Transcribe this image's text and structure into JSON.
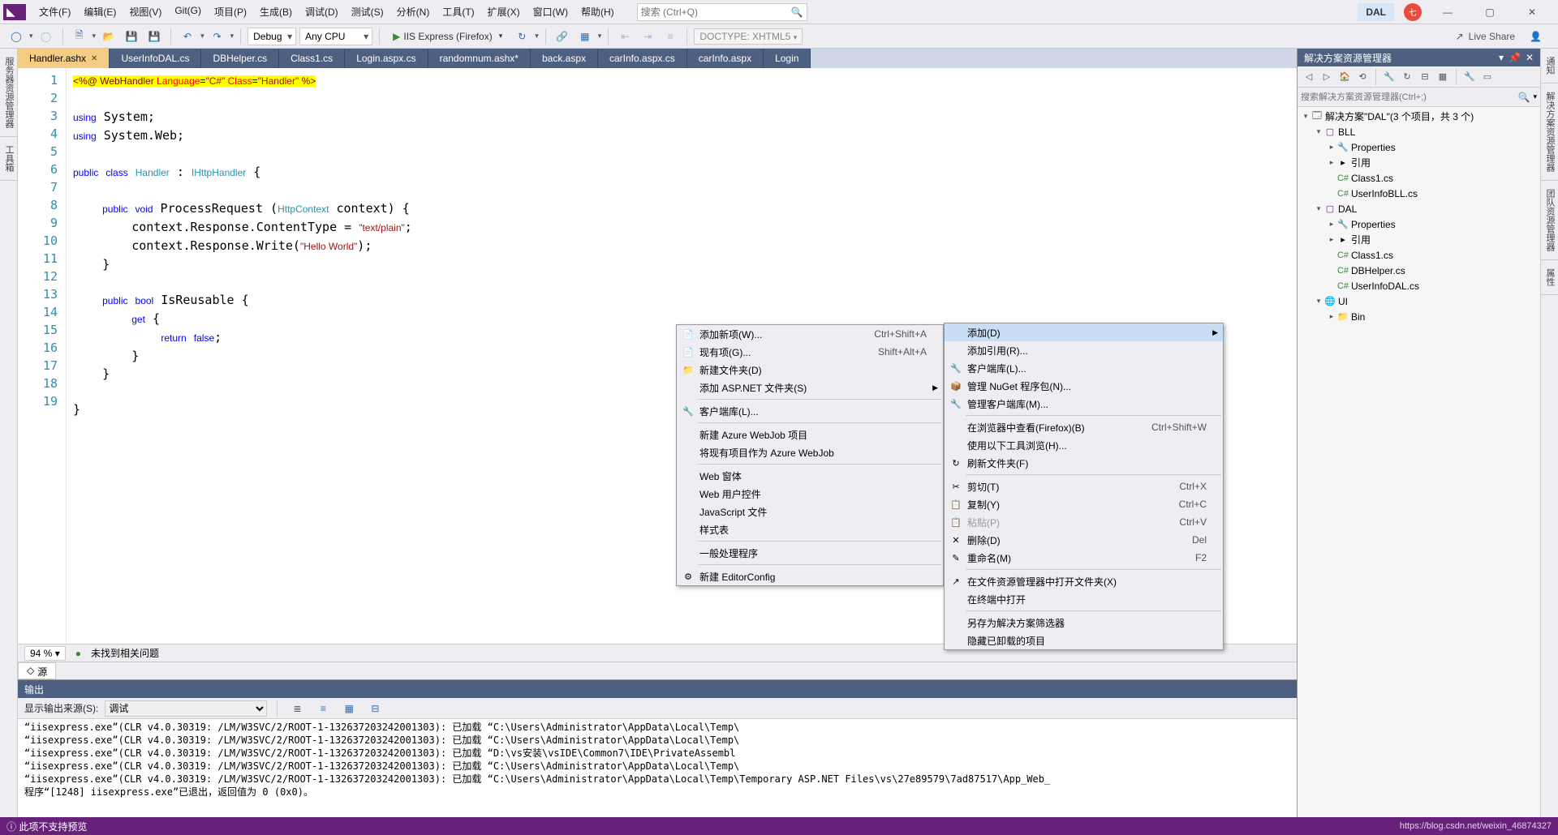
{
  "menu": {
    "items": [
      "文件(F)",
      "编辑(E)",
      "视图(V)",
      "Git(G)",
      "项目(P)",
      "生成(B)",
      "调试(D)",
      "测试(S)",
      "分析(N)",
      "工具(T)",
      "扩展(X)",
      "窗口(W)",
      "帮助(H)"
    ],
    "search_placeholder": "搜索 (Ctrl+Q)",
    "title_badge": "DAL"
  },
  "toolbar": {
    "config": "Debug",
    "platform": "Any CPU",
    "run": "IIS Express (Firefox)",
    "doctype": "DOCTYPE: XHTML5",
    "liveshare": "Live Share"
  },
  "left_tabs": [
    "服务器资源管理器",
    "工具箱"
  ],
  "right_tabs": [
    "通知",
    "解决方案资源管理器",
    "团队资源管理器",
    "属性"
  ],
  "doc_tabs": [
    "Handler.ashx",
    "UserInfoDAL.cs",
    "DBHelper.cs",
    "Class1.cs",
    "Login.aspx.cs",
    "randomnum.ashx*",
    "back.aspx",
    "carInfo.aspx.cs",
    "carInfo.aspx",
    "Login"
  ],
  "active_tab": 0,
  "code": {
    "lines": 19
  },
  "ed_status": {
    "zoom": "94 %",
    "issues": "未找到相关问题"
  },
  "src_tab": "源",
  "output": {
    "title": "输出",
    "label": "显示输出来源(S):",
    "source": "调试",
    "lines": [
      "“iisexpress.exe”(CLR v4.0.30319: /LM/W3SVC/2/ROOT-1-132637203242001303): 已加载 “C:\\Users\\Administrator\\AppData\\Local\\Temp\\",
      "“iisexpress.exe”(CLR v4.0.30319: /LM/W3SVC/2/ROOT-1-132637203242001303): 已加载 “C:\\Users\\Administrator\\AppData\\Local\\Temp\\",
      "“iisexpress.exe”(CLR v4.0.30319: /LM/W3SVC/2/ROOT-1-132637203242001303): 已加载 “D:\\vs安装\\vsIDE\\Common7\\IDE\\PrivateAssembl",
      "“iisexpress.exe”(CLR v4.0.30319: /LM/W3SVC/2/ROOT-1-132637203242001303): 已加载 “C:\\Users\\Administrator\\AppData\\Local\\Temp\\",
      "“iisexpress.exe”(CLR v4.0.30319: /LM/W3SVC/2/ROOT-1-132637203242001303): 已加载 “C:\\Users\\Administrator\\AppData\\Local\\Temp\\Temporary ASP.NET Files\\vs\\27e89579\\7ad87517\\App_Web_",
      "程序“[1248] iisexpress.exe”已退出，返回值为 0 (0x0)。"
    ]
  },
  "solution": {
    "title": "解决方案资源管理器",
    "search_placeholder": "搜索解决方案资源管理器(Ctrl+;)",
    "root": "解决方案\"DAL\"(3 个项目，共 3 个)",
    "projects": {
      "bll": {
        "name": "BLL",
        "items": [
          "Properties",
          "引用",
          "Class1.cs",
          "UserInfoBLL.cs"
        ]
      },
      "dal": {
        "name": "DAL",
        "items": [
          "Properties",
          "引用",
          "Class1.cs",
          "DBHelper.cs",
          "UserInfoDAL.cs"
        ]
      },
      "ui": {
        "name": "UI",
        "items": [
          "Bin"
        ]
      }
    }
  },
  "ctx1": {
    "items": [
      {
        "label": "添加新项(W)...",
        "shortcut": "Ctrl+Shift+A",
        "icon": "📄"
      },
      {
        "label": "现有项(G)...",
        "shortcut": "Shift+Alt+A",
        "icon": "📄"
      },
      {
        "label": "新建文件夹(D)",
        "icon": "📁"
      },
      {
        "label": "添加 ASP.NET 文件夹(S)",
        "sub": true
      },
      {
        "sep": true
      },
      {
        "label": "客户端库(L)...",
        "icon": "🔧"
      },
      {
        "sep": true
      },
      {
        "label": "新建 Azure WebJob 项目"
      },
      {
        "label": "将现有项目作为 Azure WebJob"
      },
      {
        "sep": true
      },
      {
        "label": "Web 窗体"
      },
      {
        "label": "Web 用户控件"
      },
      {
        "label": "JavaScript 文件"
      },
      {
        "label": "样式表"
      },
      {
        "sep": true
      },
      {
        "label": "一般处理程序"
      },
      {
        "sep": true
      },
      {
        "label": "新建 EditorConfig",
        "icon": "⚙"
      }
    ]
  },
  "ctx2": {
    "items": [
      {
        "label": "添加(D)",
        "sub": true,
        "hl": true
      },
      {
        "label": "添加引用(R)..."
      },
      {
        "label": "客户端库(L)...",
        "icon": "🔧"
      },
      {
        "label": "管理 NuGet 程序包(N)...",
        "icon": "📦"
      },
      {
        "label": "管理客户端库(M)...",
        "icon": "🔧"
      },
      {
        "sep": true
      },
      {
        "label": "在浏览器中查看(Firefox)(B)",
        "shortcut": "Ctrl+Shift+W"
      },
      {
        "label": "使用以下工具浏览(H)..."
      },
      {
        "label": "刷新文件夹(F)",
        "icon": "↻"
      },
      {
        "sep": true
      },
      {
        "label": "剪切(T)",
        "shortcut": "Ctrl+X",
        "icon": "✂"
      },
      {
        "label": "复制(Y)",
        "shortcut": "Ctrl+C",
        "icon": "📋"
      },
      {
        "label": "粘贴(P)",
        "shortcut": "Ctrl+V",
        "icon": "📋",
        "dis": true
      },
      {
        "label": "删除(D)",
        "shortcut": "Del",
        "icon": "✕"
      },
      {
        "label": "重命名(M)",
        "shortcut": "F2",
        "icon": "✎"
      },
      {
        "sep": true
      },
      {
        "label": "在文件资源管理器中打开文件夹(X)",
        "icon": "↗"
      },
      {
        "label": "在终端中打开"
      },
      {
        "sep": true
      },
      {
        "label": "另存为解决方案筛选器"
      },
      {
        "label": "隐藏已卸载的项目"
      }
    ]
  },
  "bottombar": {
    "left": "此项不支持预览",
    "right": "https://blog.csdn.net/weixin_46874327"
  }
}
